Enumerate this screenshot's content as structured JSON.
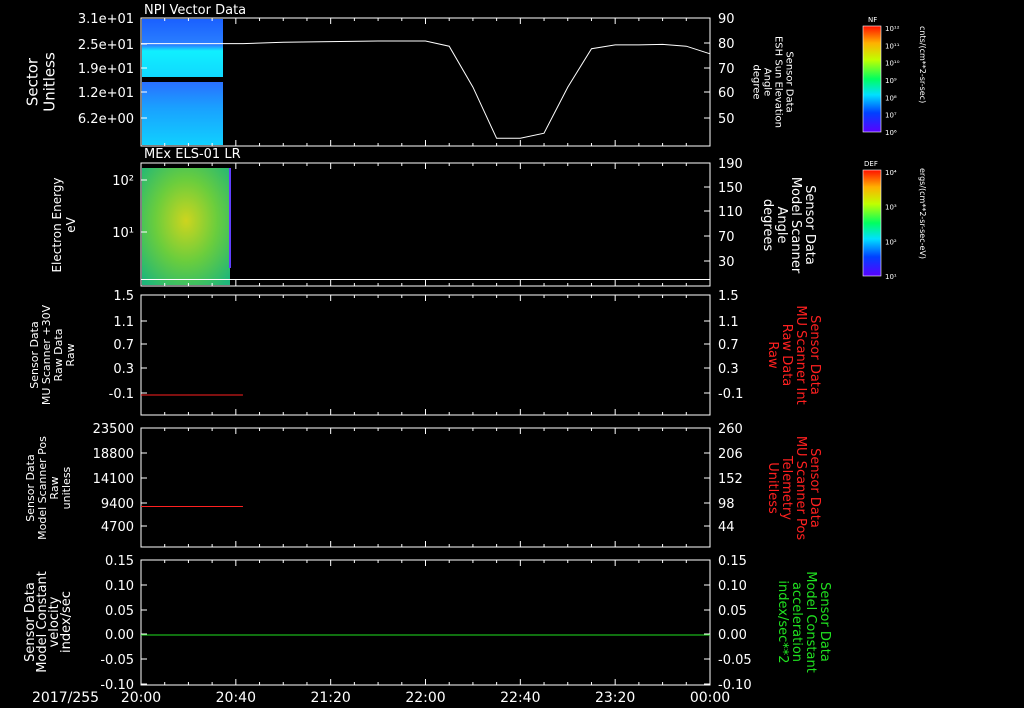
{
  "date_label": "2017/255",
  "x_ticks": [
    "20:00",
    "20:40",
    "21:20",
    "22:00",
    "22:40",
    "23:20",
    "00:00"
  ],
  "panels": [
    {
      "title": "NPI Vector Data",
      "left_label": [
        "Sector",
        "Unitless"
      ],
      "left_ticks": [
        "3.1e+01",
        "2.5e+01",
        "1.9e+01",
        "1.2e+01",
        "6.2e+00"
      ],
      "right_label": [
        "Sensor Data",
        "ESH Sun Elevation",
        "Angle",
        "degree"
      ],
      "right_ticks": [
        "90",
        "80",
        "70",
        "60",
        "50"
      ],
      "colorbar": {
        "tag": "NF",
        "unit": "cnts/(cm**2-sr-sec)",
        "ticks": [
          "10¹²",
          "10¹¹",
          "10¹⁰",
          "10⁹",
          "10⁸",
          "10⁷",
          "10⁶"
        ]
      }
    },
    {
      "title": "MEx ELS-01 LR",
      "left_label": [
        "Electron Energy",
        "eV"
      ],
      "left_ticks": [
        "10²",
        "10¹"
      ],
      "right_label": [
        "Sensor Data",
        "Model Scanner",
        "Angle",
        "degrees"
      ],
      "right_ticks": [
        "190",
        "150",
        "110",
        "70",
        "30"
      ],
      "colorbar": {
        "tag": "DEF",
        "unit": "ergs/(cm**2-sr-sec-eV)",
        "ticks": [
          "10⁴",
          "10³",
          "10²",
          "10¹"
        ]
      }
    },
    {
      "title": "",
      "left_label": [
        "Sensor Data",
        "MU Scanner +30V",
        "Raw Data",
        "Raw"
      ],
      "left_ticks": [
        "1.5",
        "1.1",
        "0.7",
        "0.3",
        "-0.1"
      ],
      "right_label": [
        "Sensor Data",
        "MU Scanner Int",
        "Raw Data",
        "Raw"
      ],
      "right_ticks": [
        "1.5",
        "1.1",
        "0.7",
        "0.3",
        "-0.1"
      ]
    },
    {
      "title": "",
      "left_label": [
        "Sensor Data",
        "Model Scanner Pos",
        "Raw",
        "unitless"
      ],
      "left_ticks": [
        "23500",
        "18800",
        "14100",
        "9400",
        "4700"
      ],
      "right_label": [
        "Sensor Data",
        "MU Scanner Pos",
        "Telemetry",
        "Unitless"
      ],
      "right_ticks": [
        "260",
        "206",
        "152",
        "98",
        "44"
      ]
    },
    {
      "title": "",
      "left_label": [
        "Sensor Data",
        "Model Constant",
        "velocity",
        "index/sec"
      ],
      "left_ticks": [
        "0.15",
        "0.10",
        "0.05",
        "0.00",
        "-0.05",
        "-0.10"
      ],
      "right_label": [
        "Sensor Data",
        "Model Constant",
        "acceleration",
        "index/sec**2"
      ],
      "right_ticks": [
        "0.15",
        "0.10",
        "0.05",
        "0.00",
        "-0.05",
        "-0.10"
      ]
    }
  ],
  "colors": {
    "axes": "#ffffff",
    "red_trace": "#ff2020",
    "green_trace": "#20e020"
  },
  "chart_data": [
    {
      "type": "line",
      "panel": "NPI Vector Data",
      "series": [
        {
          "name": "Sensor Data ESH Sun Elevation Angle",
          "x": [
            "20:00",
            "20:43",
            "21:00",
            "21:20",
            "21:40",
            "22:00",
            "22:10",
            "22:20",
            "22:30",
            "22:40",
            "22:50",
            "23:00",
            "23:10",
            "23:20",
            "23:30",
            "23:40",
            "23:50",
            "00:00"
          ],
          "y": [
            80,
            80,
            80.5,
            80.8,
            81,
            81,
            79,
            63,
            43,
            43,
            45,
            63,
            78,
            79.5,
            79.5,
            79.7,
            79,
            76
          ]
        }
      ],
      "ylim_right": [
        40,
        90
      ]
    },
    {
      "type": "line",
      "panel": "MEx ELS-01 LR",
      "series": [
        {
          "name": "Sensor Data Model Scanner Angle",
          "x": [
            "20:00",
            "00:00"
          ],
          "y": [
            10,
            10
          ]
        }
      ],
      "ylim_right": [
        0,
        190
      ]
    },
    {
      "type": "line",
      "panel": "MU Scanner +30V",
      "series": [
        {
          "name": "Sensor Data MU Scanner +30V Raw Data",
          "x": [
            "20:00",
            "20:43"
          ],
          "y": [
            0,
            0
          ]
        }
      ],
      "ylim": [
        -0.3,
        1.5
      ]
    },
    {
      "type": "line",
      "panel": "Model Scanner Pos",
      "series": [
        {
          "name": "Sensor Data Model Scanner Pos Raw",
          "x": [
            "20:00",
            "20:43"
          ],
          "y": [
            8000,
            8000
          ]
        }
      ],
      "ylim": [
        0,
        23500
      ]
    },
    {
      "type": "line",
      "panel": "Model Constant",
      "series": [
        {
          "name": "Sensor Data Model Constant acceleration",
          "x": [
            "20:00",
            "00:00"
          ],
          "y": [
            0,
            0
          ]
        }
      ],
      "ylim": [
        -0.1,
        0.15
      ]
    }
  ]
}
